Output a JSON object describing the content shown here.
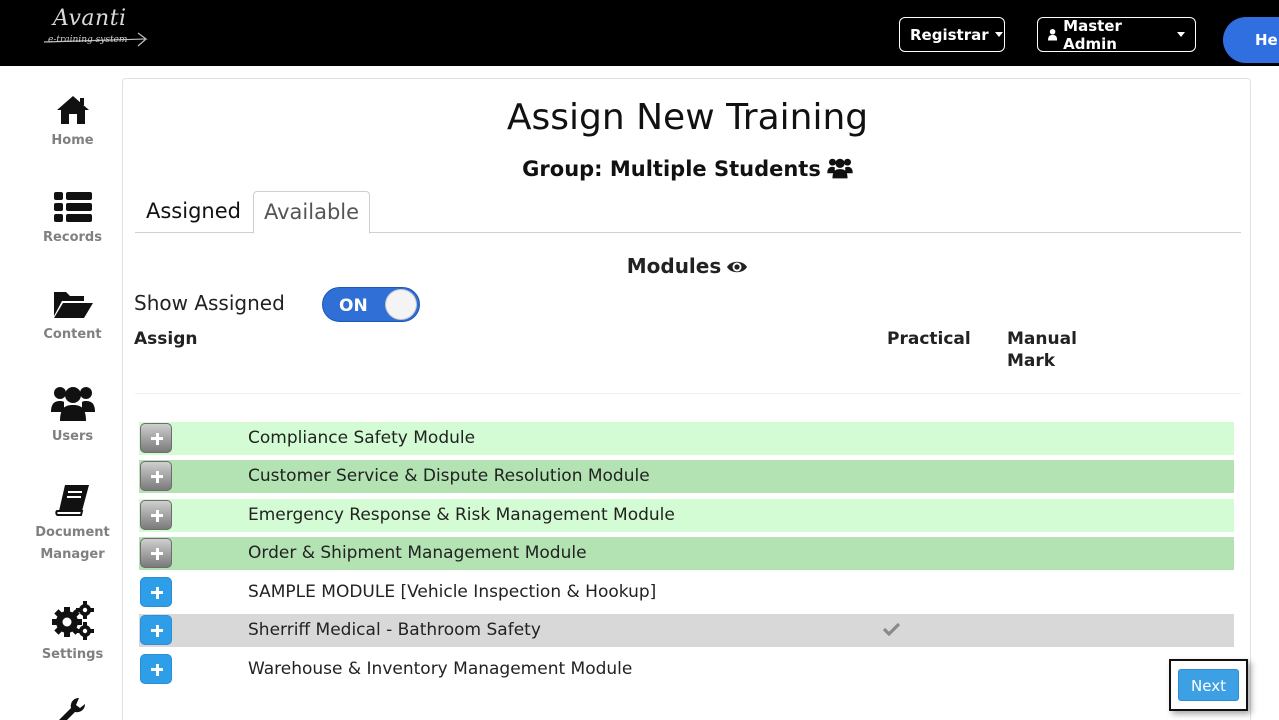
{
  "header": {
    "logo_text": "Avanti",
    "logo_subtext": "e-training system",
    "registrar_label": "Registrar",
    "master_admin_label": "Master Admin",
    "help_label": "Help"
  },
  "sidebar": {
    "items": [
      {
        "label": "Home",
        "icon": "home-icon"
      },
      {
        "label": "Records",
        "icon": "records-list-icon"
      },
      {
        "label": "Content",
        "icon": "folder-open-icon"
      },
      {
        "label": "Users",
        "icon": "users-icon"
      },
      {
        "label": "Document\nManager",
        "icon": "book-icon"
      },
      {
        "label": "Settings",
        "icon": "gears-icon"
      },
      {
        "label": "",
        "icon": "wrench-icon"
      }
    ]
  },
  "main": {
    "title": "Assign New Training",
    "group_label": "Group: Multiple Students",
    "tabs": [
      {
        "label": "Assigned",
        "active": false
      },
      {
        "label": "Available",
        "active": true
      }
    ],
    "modules_title": "Modules",
    "show_assigned_label": "Show Assigned",
    "toggle_state": "ON",
    "columns": {
      "assign": "Assign",
      "practical": "Practical",
      "manual_mark": "Manual Mark"
    },
    "rows": [
      {
        "name": "Compliance Safety Module",
        "assigned": true,
        "practical": false,
        "bg": "#d4fcd4"
      },
      {
        "name": "Customer Service & Dispute Resolution Module",
        "assigned": true,
        "practical": false,
        "bg": "#b3e2b3"
      },
      {
        "name": "Emergency Response & Risk Management Module",
        "assigned": true,
        "practical": false,
        "bg": "#d4fcd4"
      },
      {
        "name": "Order & Shipment Management Module",
        "assigned": true,
        "practical": false,
        "bg": "#b3e2b3"
      },
      {
        "name": "SAMPLE MODULE [Vehicle Inspection & Hookup]",
        "assigned": false,
        "practical": false,
        "bg": "#ffffff"
      },
      {
        "name": "Sherriff Medical - Bathroom Safety",
        "assigned": false,
        "practical": true,
        "bg": "#d8d8d8"
      },
      {
        "name": "Warehouse & Inventory Management Module",
        "assigned": false,
        "practical": false,
        "bg": "#ffffff"
      }
    ],
    "next_label": "Next"
  },
  "colors": {
    "topbar": "#000000",
    "accent_blue": "#2f6fd6",
    "add_button_blue": "#2f9ee9",
    "assigned_light": "#d4fcd4",
    "assigned_dark": "#b3e2b3"
  }
}
